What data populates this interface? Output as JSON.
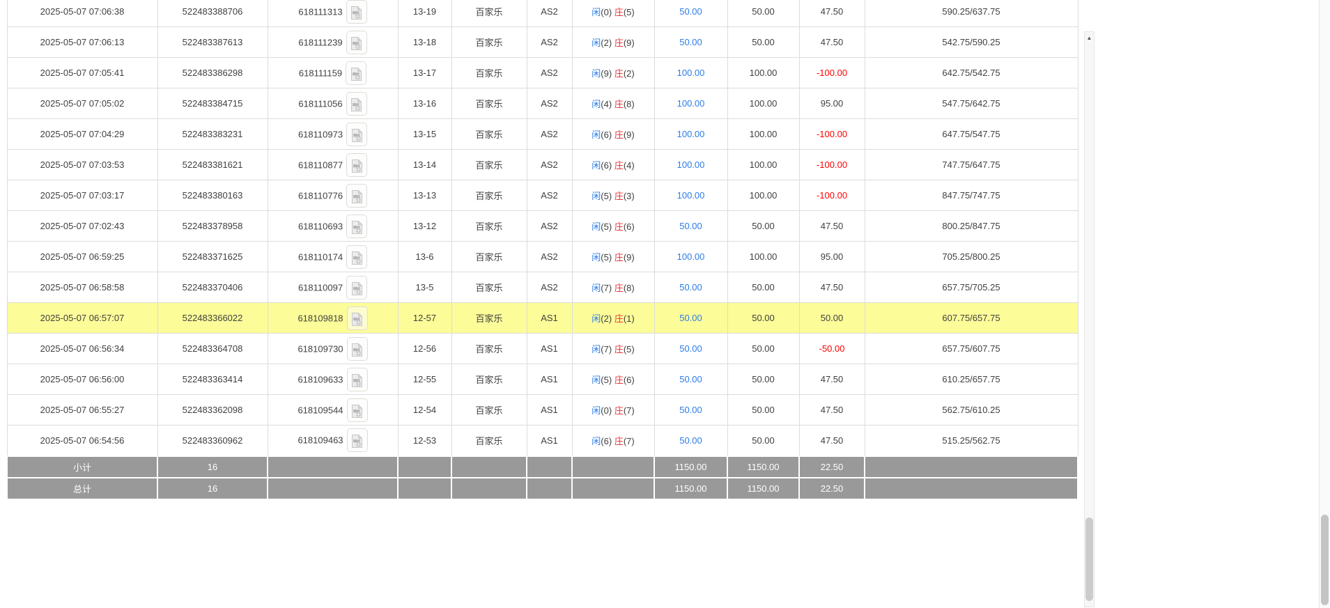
{
  "table": {
    "rows": [
      {
        "time": "2025-05-07 07:06:38",
        "order_no": "522483388706",
        "game_no": "618111313",
        "round": "13-19",
        "game": "百家乐",
        "table": "AS2",
        "result": {
          "player": "闲",
          "player_n": "(0)",
          "banker": "庄",
          "banker_n": "(5)"
        },
        "bet": "50.00",
        "valid": "50.00",
        "win_loss": "47.50",
        "balance": "590.25/637.75",
        "highlight": false
      },
      {
        "time": "2025-05-07 07:06:13",
        "order_no": "522483387613",
        "game_no": "618111239",
        "round": "13-18",
        "game": "百家乐",
        "table": "AS2",
        "result": {
          "player": "闲",
          "player_n": "(2)",
          "banker": "庄",
          "banker_n": "(9)"
        },
        "bet": "50.00",
        "valid": "50.00",
        "win_loss": "47.50",
        "balance": "542.75/590.25",
        "highlight": false
      },
      {
        "time": "2025-05-07 07:05:41",
        "order_no": "522483386298",
        "game_no": "618111159",
        "round": "13-17",
        "game": "百家乐",
        "table": "AS2",
        "result": {
          "player": "闲",
          "player_n": "(9)",
          "banker": "庄",
          "banker_n": "(2)"
        },
        "bet": "100.00",
        "valid": "100.00",
        "win_loss": "-100.00",
        "balance": "642.75/542.75",
        "highlight": false
      },
      {
        "time": "2025-05-07 07:05:02",
        "order_no": "522483384715",
        "game_no": "618111056",
        "round": "13-16",
        "game": "百家乐",
        "table": "AS2",
        "result": {
          "player": "闲",
          "player_n": "(4)",
          "banker": "庄",
          "banker_n": "(8)"
        },
        "bet": "100.00",
        "valid": "100.00",
        "win_loss": "95.00",
        "balance": "547.75/642.75",
        "highlight": false
      },
      {
        "time": "2025-05-07 07:04:29",
        "order_no": "522483383231",
        "game_no": "618110973",
        "round": "13-15",
        "game": "百家乐",
        "table": "AS2",
        "result": {
          "player": "闲",
          "player_n": "(6)",
          "banker": "庄",
          "banker_n": "(9)"
        },
        "bet": "100.00",
        "valid": "100.00",
        "win_loss": "-100.00",
        "balance": "647.75/547.75",
        "highlight": false
      },
      {
        "time": "2025-05-07 07:03:53",
        "order_no": "522483381621",
        "game_no": "618110877",
        "round": "13-14",
        "game": "百家乐",
        "table": "AS2",
        "result": {
          "player": "闲",
          "player_n": "(6)",
          "banker": "庄",
          "banker_n": "(4)"
        },
        "bet": "100.00",
        "valid": "100.00",
        "win_loss": "-100.00",
        "balance": "747.75/647.75",
        "highlight": false
      },
      {
        "time": "2025-05-07 07:03:17",
        "order_no": "522483380163",
        "game_no": "618110776",
        "round": "13-13",
        "game": "百家乐",
        "table": "AS2",
        "result": {
          "player": "闲",
          "player_n": "(5)",
          "banker": "庄",
          "banker_n": "(3)"
        },
        "bet": "100.00",
        "valid": "100.00",
        "win_loss": "-100.00",
        "balance": "847.75/747.75",
        "highlight": false
      },
      {
        "time": "2025-05-07 07:02:43",
        "order_no": "522483378958",
        "game_no": "618110693",
        "round": "13-12",
        "game": "百家乐",
        "table": "AS2",
        "result": {
          "player": "闲",
          "player_n": "(5)",
          "banker": "庄",
          "banker_n": "(6)"
        },
        "bet": "50.00",
        "valid": "50.00",
        "win_loss": "47.50",
        "balance": "800.25/847.75",
        "highlight": false
      },
      {
        "time": "2025-05-07 06:59:25",
        "order_no": "522483371625",
        "game_no": "618110174",
        "round": "13-6",
        "game": "百家乐",
        "table": "AS2",
        "result": {
          "player": "闲",
          "player_n": "(5)",
          "banker": "庄",
          "banker_n": "(9)"
        },
        "bet": "100.00",
        "valid": "100.00",
        "win_loss": "95.00",
        "balance": "705.25/800.25",
        "highlight": false
      },
      {
        "time": "2025-05-07 06:58:58",
        "order_no": "522483370406",
        "game_no": "618110097",
        "round": "13-5",
        "game": "百家乐",
        "table": "AS2",
        "result": {
          "player": "闲",
          "player_n": "(7)",
          "banker": "庄",
          "banker_n": "(8)"
        },
        "bet": "50.00",
        "valid": "50.00",
        "win_loss": "47.50",
        "balance": "657.75/705.25",
        "highlight": false
      },
      {
        "time": "2025-05-07 06:57:07",
        "order_no": "522483366022",
        "game_no": "618109818",
        "round": "12-57",
        "game": "百家乐",
        "table": "AS1",
        "result": {
          "player": "闲",
          "player_n": "(2)",
          "banker": "庄",
          "banker_n": "(1)"
        },
        "bet": "50.00",
        "valid": "50.00",
        "win_loss": "50.00",
        "balance": "607.75/657.75",
        "highlight": true
      },
      {
        "time": "2025-05-07 06:56:34",
        "order_no": "522483364708",
        "game_no": "618109730",
        "round": "12-56",
        "game": "百家乐",
        "table": "AS1",
        "result": {
          "player": "闲",
          "player_n": "(7)",
          "banker": "庄",
          "banker_n": "(5)"
        },
        "bet": "50.00",
        "valid": "50.00",
        "win_loss": "-50.00",
        "balance": "657.75/607.75",
        "highlight": false
      },
      {
        "time": "2025-05-07 06:56:00",
        "order_no": "522483363414",
        "game_no": "618109633",
        "round": "12-55",
        "game": "百家乐",
        "table": "AS1",
        "result": {
          "player": "闲",
          "player_n": "(5)",
          "banker": "庄",
          "banker_n": "(6)"
        },
        "bet": "50.00",
        "valid": "50.00",
        "win_loss": "47.50",
        "balance": "610.25/657.75",
        "highlight": false
      },
      {
        "time": "2025-05-07 06:55:27",
        "order_no": "522483362098",
        "game_no": "618109544",
        "round": "12-54",
        "game": "百家乐",
        "table": "AS1",
        "result": {
          "player": "闲",
          "player_n": "(0)",
          "banker": "庄",
          "banker_n": "(7)"
        },
        "bet": "50.00",
        "valid": "50.00",
        "win_loss": "47.50",
        "balance": "562.75/610.25",
        "highlight": false
      },
      {
        "time": "2025-05-07 06:54:56",
        "order_no": "522483360962",
        "game_no": "618109463",
        "round": "12-53",
        "game": "百家乐",
        "table": "AS1",
        "result": {
          "player": "闲",
          "player_n": "(6)",
          "banker": "庄",
          "banker_n": "(7)"
        },
        "bet": "50.00",
        "valid": "50.00",
        "win_loss": "47.50",
        "balance": "515.25/562.75",
        "highlight": false
      }
    ],
    "subtotal": {
      "label": "小计",
      "count": "16",
      "bet": "1150.00",
      "valid": "1150.00",
      "win_loss": "22.50"
    },
    "total": {
      "label": "总计",
      "count": "16",
      "bet": "1150.00",
      "valid": "1150.00",
      "win_loss": "22.50"
    }
  },
  "icons": {
    "video_replay": "video-file-icon",
    "scroll_up": "chevron-up-icon"
  },
  "colors": {
    "link_blue": "#2b7ce9",
    "player_blue": "#2b7ce9",
    "banker_red": "#e4393c",
    "negative_red": "#ff0000",
    "highlight_yellow": "#fcfc99",
    "summary_gray": "#999999",
    "border_gray": "#dcdcdc"
  }
}
